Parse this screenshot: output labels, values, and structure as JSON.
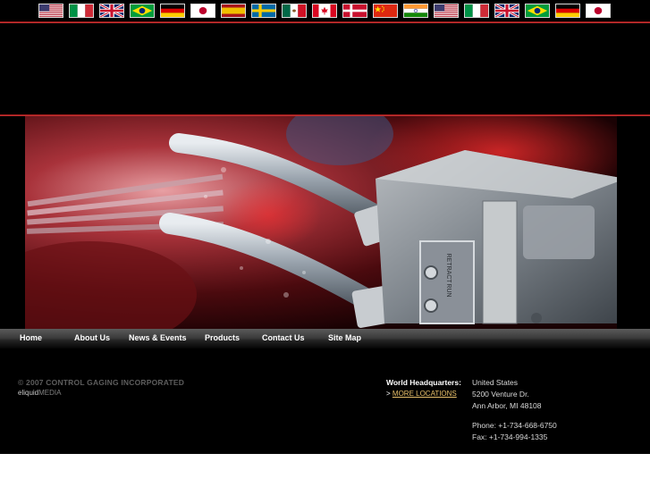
{
  "languages": [
    {
      "icon": "us-flag-icon"
    },
    {
      "icon": "italy-flag-icon"
    },
    {
      "icon": "uk-flag-icon"
    },
    {
      "icon": "brazil-flag-icon"
    },
    {
      "icon": "germany-flag-icon"
    },
    {
      "icon": "japan-flag-icon"
    },
    {
      "icon": "spain-flag-icon"
    },
    {
      "icon": "sweden-flag-icon"
    },
    {
      "icon": "mexico-flag-icon"
    },
    {
      "icon": "canada-flag-icon"
    },
    {
      "icon": "denmark-flag-icon"
    },
    {
      "icon": "china-flag-icon"
    },
    {
      "icon": "india-flag-icon"
    },
    {
      "icon": "us-flag-icon"
    },
    {
      "icon": "italy-flag-icon"
    },
    {
      "icon": "uk-flag-icon"
    },
    {
      "icon": "brazil-flag-icon"
    },
    {
      "icon": "germany-flag-icon"
    },
    {
      "icon": "japan-flag-icon"
    }
  ],
  "nav": {
    "home": "Home",
    "about": "About Us",
    "news": "News & Events",
    "products": "Products",
    "contact": "Contact Us",
    "sitemap": "Site Map"
  },
  "footer": {
    "copyright": "© 2007 CONTROL GAGING INCORPORATED",
    "credit_prefix": "eliquid",
    "credit_suffix": "MEDIA",
    "hq_label": "World Headquarters:",
    "more_prefix": ">",
    "more_link": "MORE LOCATIONS",
    "country": "United States",
    "street": "5200 Venture Dr.",
    "city": "Ann Arbor, MI 48108",
    "phone": "Phone: +1-734-668-6750",
    "fax": "Fax: +1-734-994-1335"
  },
  "colors": {
    "background": "#000000",
    "accent_red": "#c0282c",
    "link_gold": "#e8c06a"
  }
}
